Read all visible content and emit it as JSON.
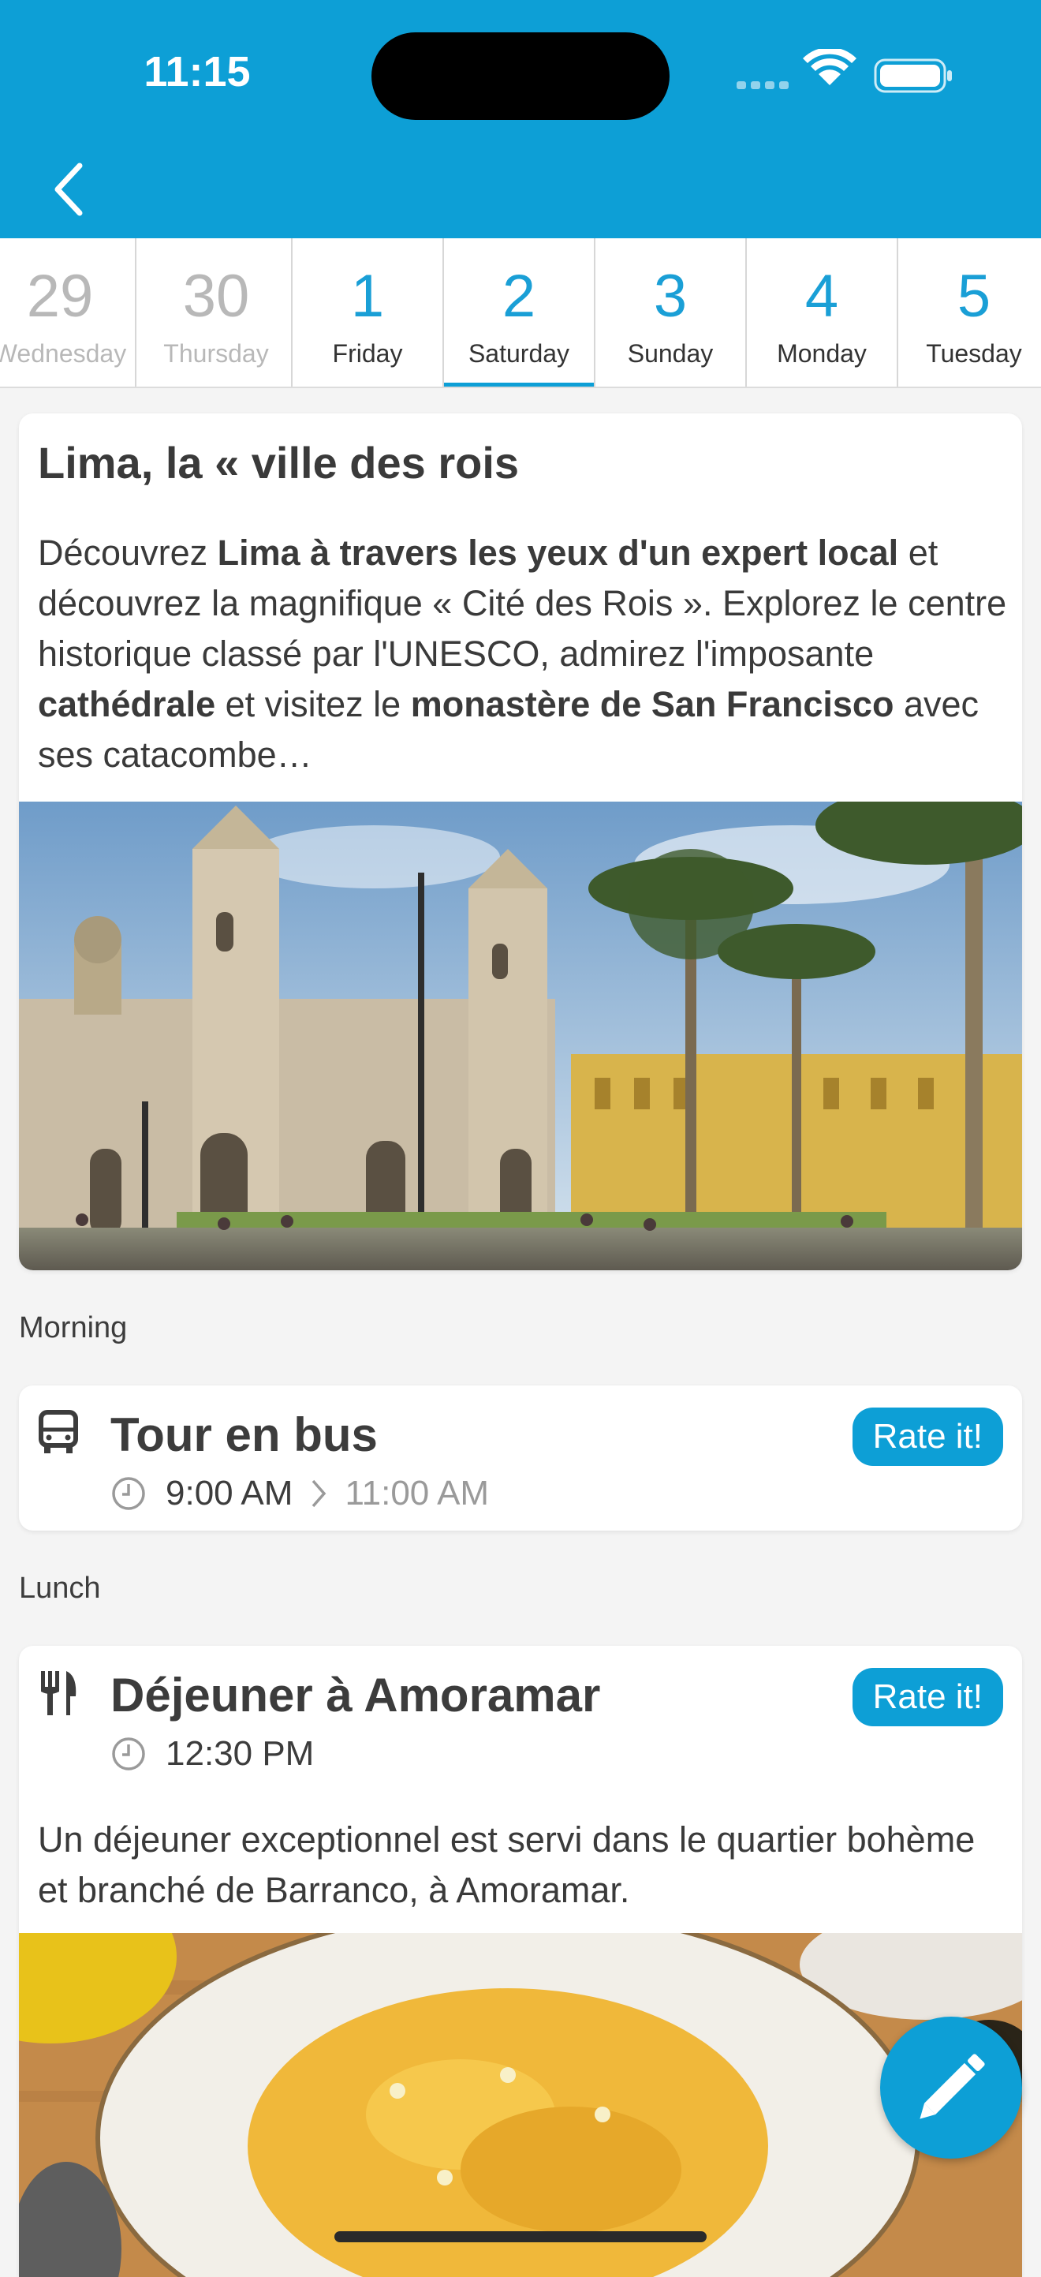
{
  "status_bar": {
    "time": "11:15"
  },
  "nav": {
    "back_icon": "chevron-left-icon"
  },
  "days": [
    {
      "num": "29",
      "name": "Wednesday",
      "state": "past"
    },
    {
      "num": "30",
      "name": "Thursday",
      "state": "past"
    },
    {
      "num": "1",
      "name": "Friday",
      "state": "future"
    },
    {
      "num": "2",
      "name": "Saturday",
      "state": "active"
    },
    {
      "num": "3",
      "name": "Sunday",
      "state": "future"
    },
    {
      "num": "4",
      "name": "Monday",
      "state": "future"
    },
    {
      "num": "5",
      "name": "Tuesday",
      "state": "future"
    }
  ],
  "intro": {
    "title": "Lima, la « ville des rois",
    "desc": [
      {
        "t": "Découvrez ",
        "b": false
      },
      {
        "t": "Lima à travers les yeux d'un expert local",
        "b": true
      },
      {
        "t": " et découvrez la magnifique « Cité des Rois ». Explorez le centre historique classé par l'UNESCO, admirez l'imposante ",
        "b": false
      },
      {
        "t": "cathédrale",
        "b": true
      },
      {
        "t": " et visitez le ",
        "b": false
      },
      {
        "t": "monastère de San Francisco",
        "b": true
      },
      {
        "t": " avec ses catacombe…",
        "b": false
      }
    ]
  },
  "sections": {
    "morning": "Morning",
    "lunch": "Lunch"
  },
  "bus_event": {
    "title": "Tour en bus",
    "start": "9:00 AM",
    "end": "11:00 AM",
    "rate_label": "Rate it!",
    "icon": "bus-icon"
  },
  "lunch_event": {
    "title": "Déjeuner à Amoramar",
    "start": "12:30 PM",
    "rate_label": "Rate it!",
    "icon": "fork-knife-icon",
    "desc": "Un déjeuner exceptionnel est servi dans le quartier bohème et branché de Barranco, à Amoramar."
  },
  "fab": {
    "icon": "pencil-icon"
  },
  "colors": {
    "accent": "#0d9fd6",
    "past_day": "#b8b8b8"
  }
}
